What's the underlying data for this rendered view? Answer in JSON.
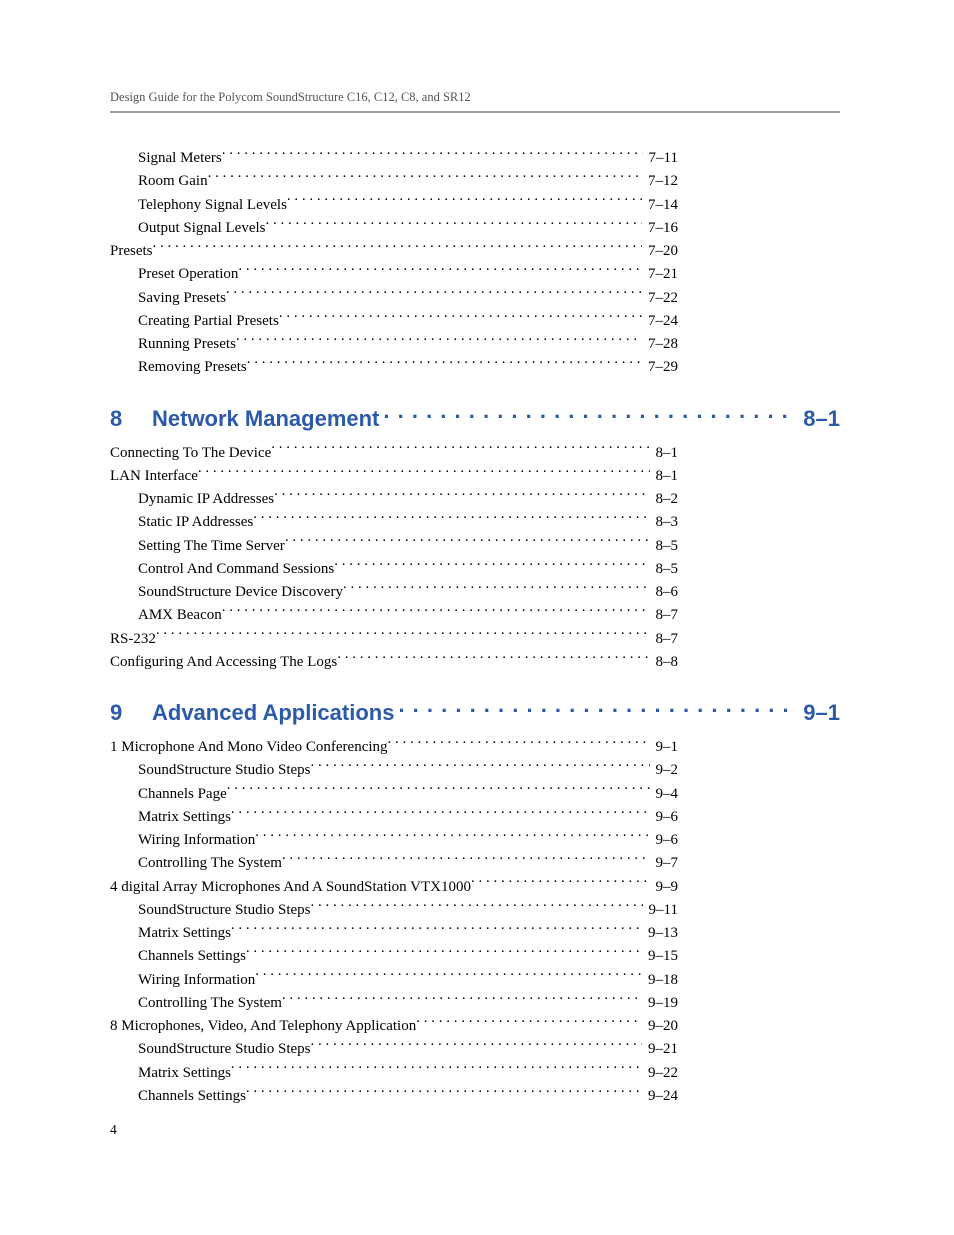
{
  "header": {
    "running_head": "Design Guide for the Polycom SoundStructure C16, C12, C8, and SR12"
  },
  "footer": {
    "page_number": "4"
  },
  "toc": {
    "pre_entries": [
      {
        "level": 2,
        "label": "Signal Meters",
        "page": "7–11"
      },
      {
        "level": 2,
        "label": "Room Gain",
        "page": "7–12"
      },
      {
        "level": 2,
        "label": "Telephony Signal Levels",
        "page": "7–14"
      },
      {
        "level": 2,
        "label": "Output Signal Levels",
        "page": "7–16"
      },
      {
        "level": 1,
        "label": "Presets",
        "page": "7–20"
      },
      {
        "level": 2,
        "label": "Preset Operation",
        "page": "7–21"
      },
      {
        "level": 2,
        "label": "Saving Presets",
        "page": "7–22"
      },
      {
        "level": 2,
        "label": "Creating Partial Presets",
        "page": "7–24"
      },
      {
        "level": 2,
        "label": "Running Presets",
        "page": "7–28"
      },
      {
        "level": 2,
        "label": "Removing Presets",
        "page": "7–29"
      }
    ],
    "chapters": [
      {
        "number": "8",
        "title": "Network Management",
        "page": "8–1",
        "entries": [
          {
            "level": 1,
            "label": "Connecting To The Device",
            "page": "8–1"
          },
          {
            "level": 1,
            "label": "LAN Interface",
            "page": "8–1"
          },
          {
            "level": 2,
            "label": "Dynamic IP Addresses",
            "page": "8–2"
          },
          {
            "level": 2,
            "label": "Static IP Addresses",
            "page": "8–3"
          },
          {
            "level": 2,
            "label": "Setting The Time Server",
            "page": "8–5"
          },
          {
            "level": 2,
            "label": "Control And Command Sessions",
            "page": "8–5"
          },
          {
            "level": 2,
            "label": "SoundStructure Device Discovery",
            "page": "8–6"
          },
          {
            "level": 2,
            "label": "AMX Beacon",
            "page": "8–7"
          },
          {
            "level": 1,
            "label": "RS-232",
            "page": "8–7"
          },
          {
            "level": 1,
            "label": "Configuring And Accessing The Logs",
            "page": "8–8"
          }
        ]
      },
      {
        "number": "9",
        "title": "Advanced Applications",
        "page": "9–1",
        "entries": [
          {
            "level": 1,
            "label": "1 Microphone And Mono Video Conferencing",
            "page": "9–1"
          },
          {
            "level": 2,
            "label": "SoundStructure Studio Steps",
            "page": "9–2"
          },
          {
            "level": 2,
            "label": "Channels Page",
            "page": "9–4"
          },
          {
            "level": 2,
            "label": "Matrix Settings",
            "page": "9–6"
          },
          {
            "level": 2,
            "label": "Wiring Information",
            "page": "9–6"
          },
          {
            "level": 2,
            "label": "Controlling The System",
            "page": "9–7"
          },
          {
            "level": 1,
            "label": "4 digital Array Microphones And A SoundStation VTX1000",
            "page": "9–9"
          },
          {
            "level": 2,
            "label": "SoundStructure Studio Steps",
            "page": "9–11"
          },
          {
            "level": 2,
            "label": "Matrix Settings",
            "page": "9–13"
          },
          {
            "level": 2,
            "label": "Channels Settings",
            "page": "9–15"
          },
          {
            "level": 2,
            "label": "Wiring Information",
            "page": "9–18"
          },
          {
            "level": 2,
            "label": "Controlling The System",
            "page": "9–19"
          },
          {
            "level": 1,
            "label": "8 Microphones, Video, And Telephony Application",
            "page": "9–20"
          },
          {
            "level": 2,
            "label": "SoundStructure Studio Steps",
            "page": "9–21"
          },
          {
            "level": 2,
            "label": "Matrix Settings",
            "page": "9–22"
          },
          {
            "level": 2,
            "label": "Channels Settings",
            "page": "9–24"
          }
        ]
      }
    ]
  }
}
